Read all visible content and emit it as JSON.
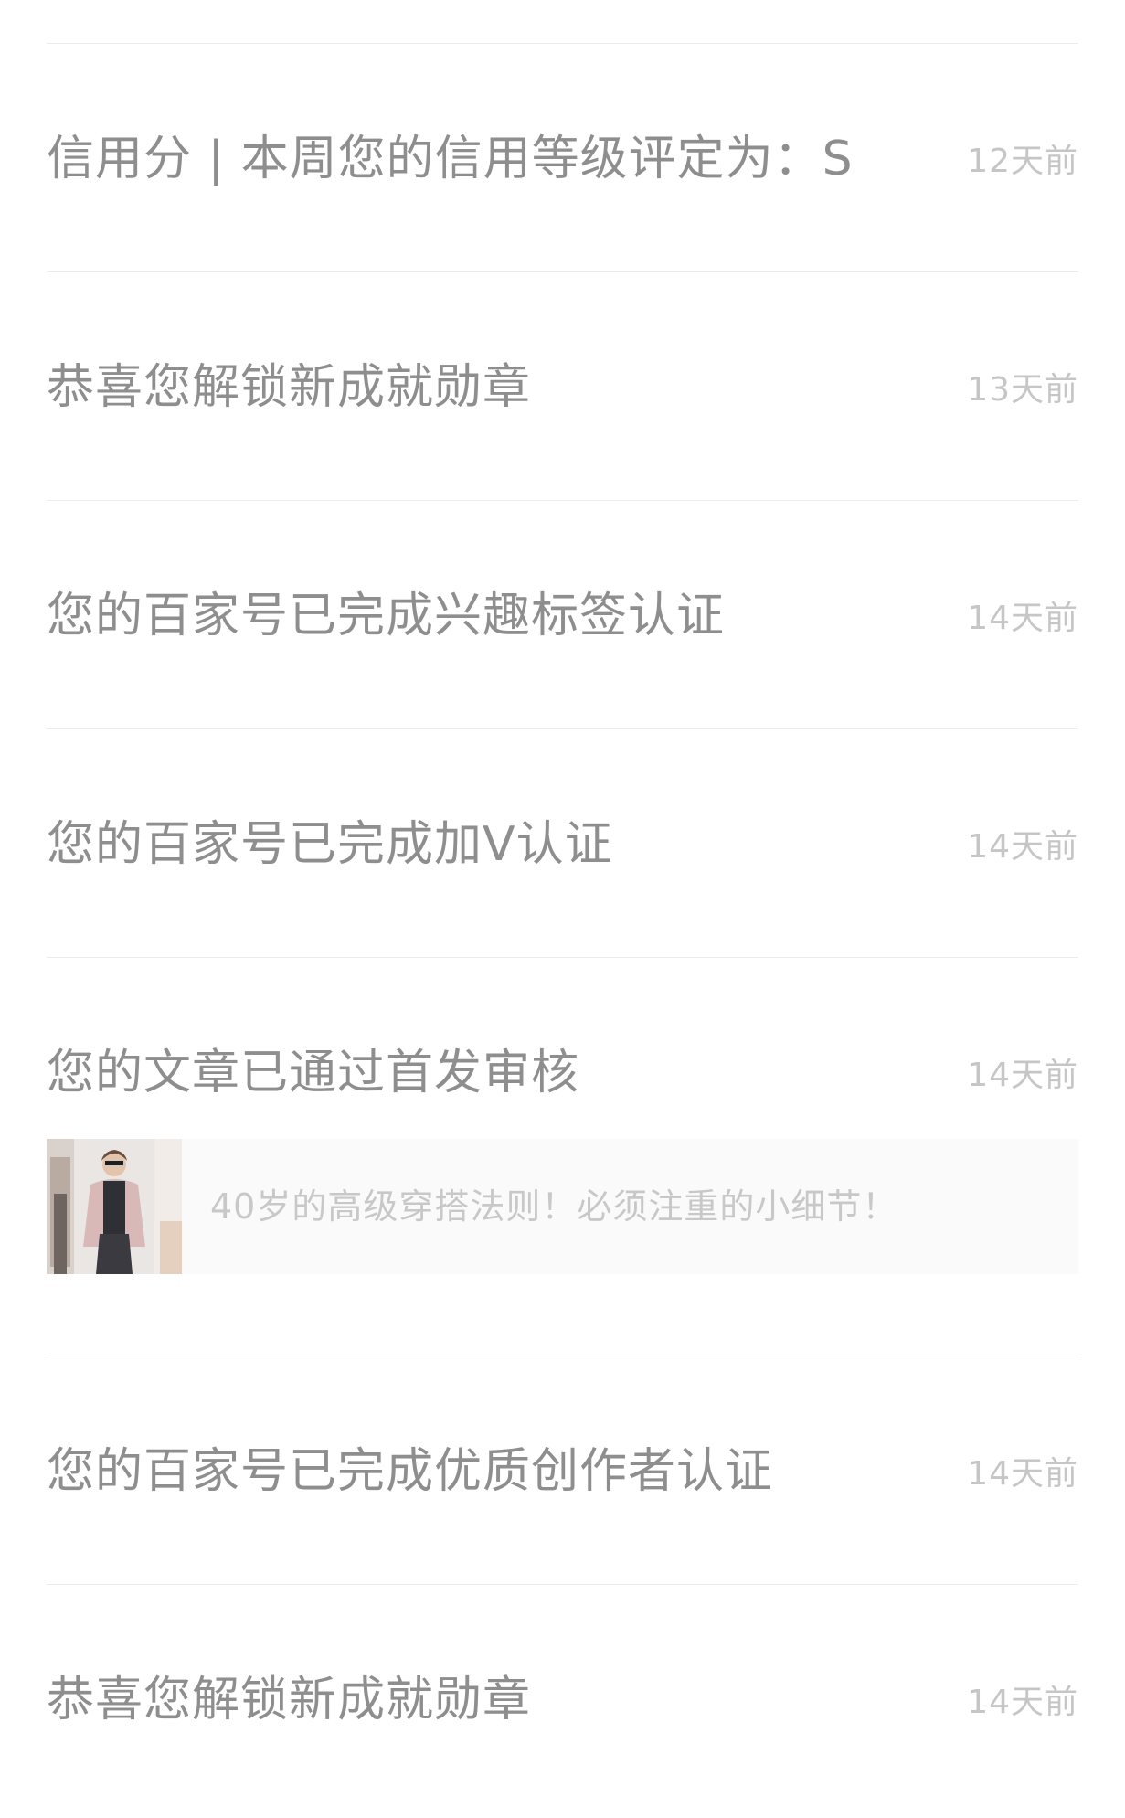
{
  "notifications": [
    {
      "title": "信用分 | 本周您的信用等级评定为：S",
      "time": "12天前"
    },
    {
      "title": "恭喜您解锁新成就勋章",
      "time": "13天前"
    },
    {
      "title": "您的百家号已完成兴趣标签认证",
      "time": "14天前"
    },
    {
      "title": "您的百家号已完成加V认证",
      "time": "14天前"
    },
    {
      "title": "您的文章已通过首发审核",
      "time": "14天前",
      "article": {
        "title": "40岁的高级穿搭法则！必须注重的小细节！",
        "thumbnail": "fashion-photo"
      }
    },
    {
      "title": "您的百家号已完成优质创作者认证",
      "time": "14天前"
    },
    {
      "title": "恭喜您解锁新成就勋章",
      "time": "14天前"
    }
  ],
  "colors": {
    "title": "#8e8e8e",
    "time": "#c6c6c6",
    "divider": "#ececec",
    "card_bg": "#fafafa"
  }
}
